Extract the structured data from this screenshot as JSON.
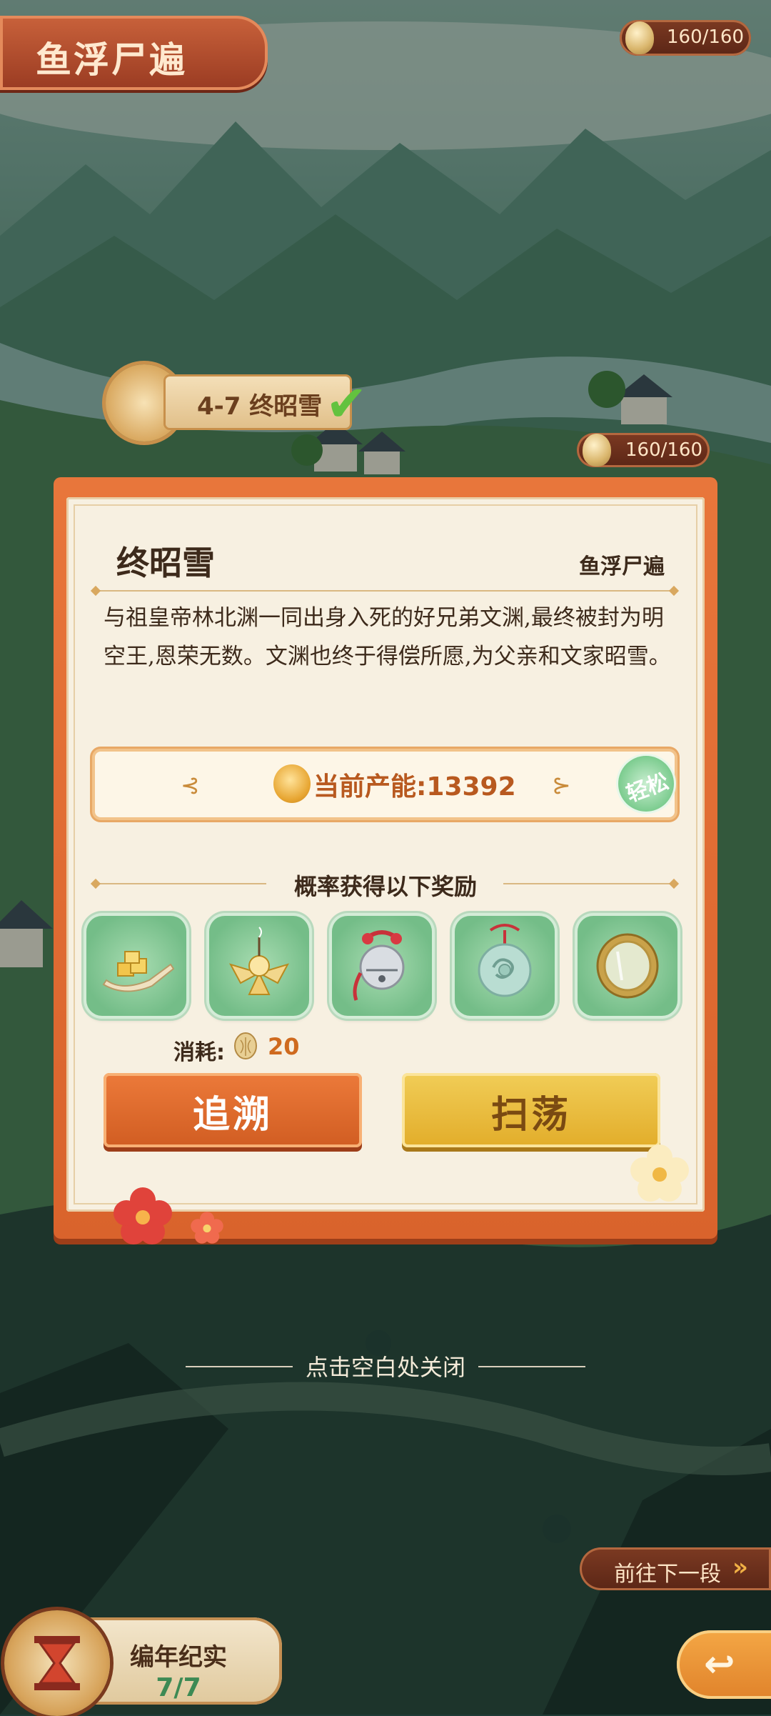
{
  "hud": {
    "chapter_title": "鱼浮尸遍",
    "stamina_top": "160/160",
    "stamina_map": "160/160"
  },
  "map": {
    "node_label": "4-7 终昭雪"
  },
  "dialog": {
    "title": "终昭雪",
    "chapter": "鱼浮尸遍",
    "description": "与祖皇帝林北渊一同出身入死的好兄弟文渊,最终被封为明空王,恩荣无数。文渊也终于得偿所愿,为父亲和文家昭雪。",
    "power_label": "当前产能:13392",
    "difficulty_badge": "轻松",
    "reward_heading": "概率获得以下奖励",
    "rewards": [
      {
        "name": "gold-ingot-spoon-icon"
      },
      {
        "name": "incense-flower-icon"
      },
      {
        "name": "silver-bell-icon"
      },
      {
        "name": "jade-pendant-icon"
      },
      {
        "name": "bronze-mirror-icon"
      }
    ],
    "cost_label": "消耗:",
    "cost_value": "20",
    "pursue_button": "追溯",
    "sweep_button": "扫荡"
  },
  "close_hint": "点击空白处关闭",
  "next_section": "前往下一段",
  "chronicle": {
    "title": "编年纪实",
    "count": "7/7"
  },
  "colors": {
    "accent_orange": "#e8763b",
    "button_gold": "#e2ad2a",
    "reward_green": "#74bd88",
    "parchment": "#f7f0e1"
  }
}
